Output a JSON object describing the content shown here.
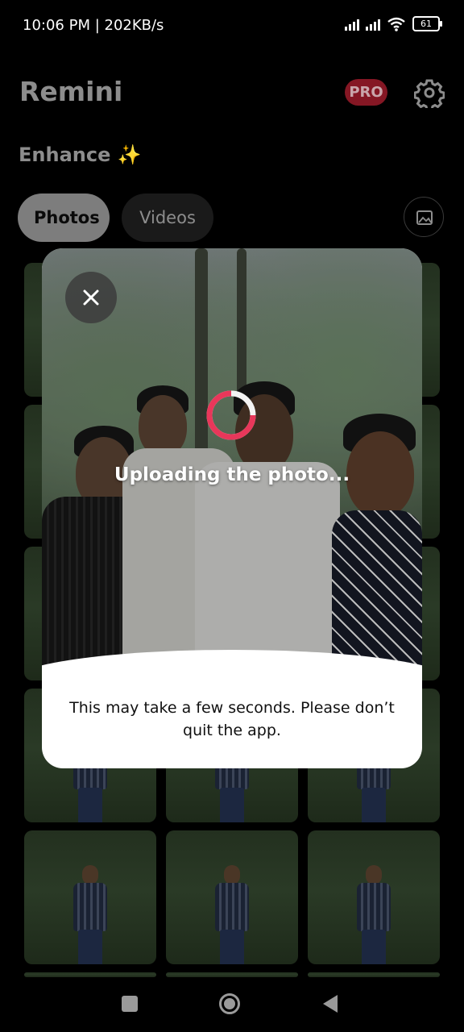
{
  "status_bar": {
    "time_speed": "10:06 PM | 202KB/s",
    "battery": "61"
  },
  "header": {
    "title": "Remini",
    "pro_badge": "PRO",
    "settings_icon": "gear-icon"
  },
  "section": {
    "title": "Enhance ✨"
  },
  "tabs": [
    {
      "label": "Photos",
      "active": true
    },
    {
      "label": "Videos",
      "active": false
    }
  ],
  "gallery_icon": "image-icon",
  "modal": {
    "close_icon": "close-icon",
    "status": "Uploading the photo...",
    "message": "This may take a few seconds. Please don’t quit the app.",
    "spinner_color": "#e8375a"
  },
  "nav": {
    "recents_icon": "square-icon",
    "home_icon": "circle-icon",
    "back_icon": "triangle-back-icon"
  }
}
